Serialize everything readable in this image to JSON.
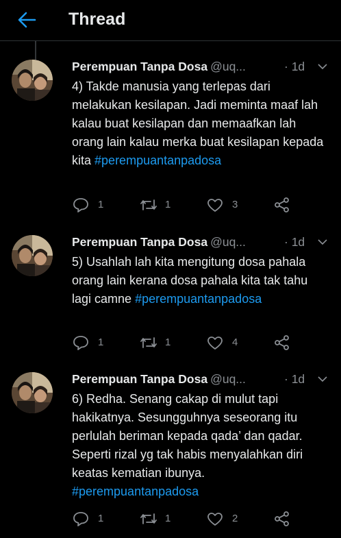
{
  "header": {
    "title": "Thread"
  },
  "tweets": [
    {
      "name": "Perempuan Tanpa Dosa",
      "handle": "@uq...",
      "time": "· 1d",
      "text": "4) Takde manusia yang terlepas dari melakukan kesilapan. Jadi meminta maaf lah kalau buat kesilapan dan memaafkan lah orang lain kalau merka buat kesilapan kepada kita",
      "hashtag": "#perempuantanpadosa",
      "replies": "1",
      "retweets": "1",
      "likes": "3"
    },
    {
      "name": "Perempuan Tanpa Dosa",
      "handle": "@uq...",
      "time": "· 1d",
      "text": "5) Usahlah lah kita mengitung dosa pahala orang lain kerana dosa pahala kita tak tahu lagi camne",
      "hashtag": "#perempuantanpadosa",
      "replies": "1",
      "retweets": "1",
      "likes": "4"
    },
    {
      "name": "Perempuan Tanpa Dosa",
      "handle": "@uq...",
      "time": "· 1d",
      "text": "6) Redha. Senang cakap di mulut tapi hakikatnya. Sesungguhnya seseorang itu perlulah beriman kepada qada’ dan qadar. Seperti rizal yg tak habis menyalahkan diri keatas kematian ibunya.",
      "hashtag": "#perempuantanpadosa",
      "replies": "1",
      "retweets": "1",
      "likes": "2"
    }
  ],
  "colors": {
    "accent": "#1d9bf0",
    "background": "#000000",
    "muted": "#8b8f94"
  },
  "icons": [
    "back-arrow-icon",
    "chevron-down-icon",
    "reply-icon",
    "retweet-icon",
    "like-icon",
    "share-icon"
  ]
}
